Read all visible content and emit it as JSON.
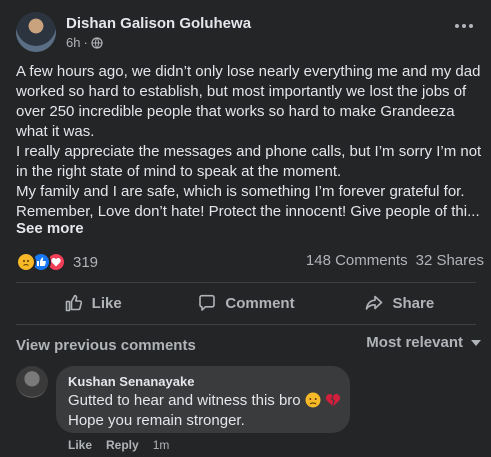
{
  "post": {
    "author": "Dishan Galison Goluhewa",
    "time": "6h",
    "separator": "·",
    "privacy_icon": "globe-icon",
    "more_icon": "more-horizontal-icon",
    "text_lines": [
      "A few hours ago, we didn’t only lose nearly everything me and my dad",
      "worked so hard to establish, but most importantly we lost the jobs of",
      "over 250 incredible people that works so hard to make Grandeeza",
      "what it was.",
      "I really appreciate the messages and phone calls, but I’m sorry I’m not",
      "in the right state of mind to speak at the moment.",
      "My family and I are safe, which is something I’m forever grateful for.",
      "Remember, Love don’t hate! Protect the innocent! Give people of thi..."
    ],
    "see_more": "See more"
  },
  "stats": {
    "reaction_icons": [
      "sad-reaction-icon",
      "like-reaction-icon",
      "love-reaction-icon"
    ],
    "reaction_count": "319",
    "comments": "148 Comments",
    "shares": "32 Shares"
  },
  "actions": {
    "like": "Like",
    "comment": "Comment",
    "share": "Share"
  },
  "comments_section": {
    "view_previous": "View previous comments",
    "sort": "Most relevant",
    "comment": {
      "author": "Kushan Senanayake",
      "line1": "Gutted to hear and witness this bro",
      "line1_emojis": [
        "disappointed-face-emoji",
        "broken-heart-emoji"
      ],
      "line2": "Hope you remain stronger.",
      "like": "Like",
      "reply": "Reply",
      "time": "1m"
    }
  },
  "colors": {
    "background": "#242526",
    "text_primary": "#e4e6eb",
    "text_secondary": "#b0b3b8",
    "bubble": "#3a3b3c",
    "like_blue": "#1877f2",
    "love_red": "#f33e58",
    "sad_yellow": "#f7b928"
  }
}
